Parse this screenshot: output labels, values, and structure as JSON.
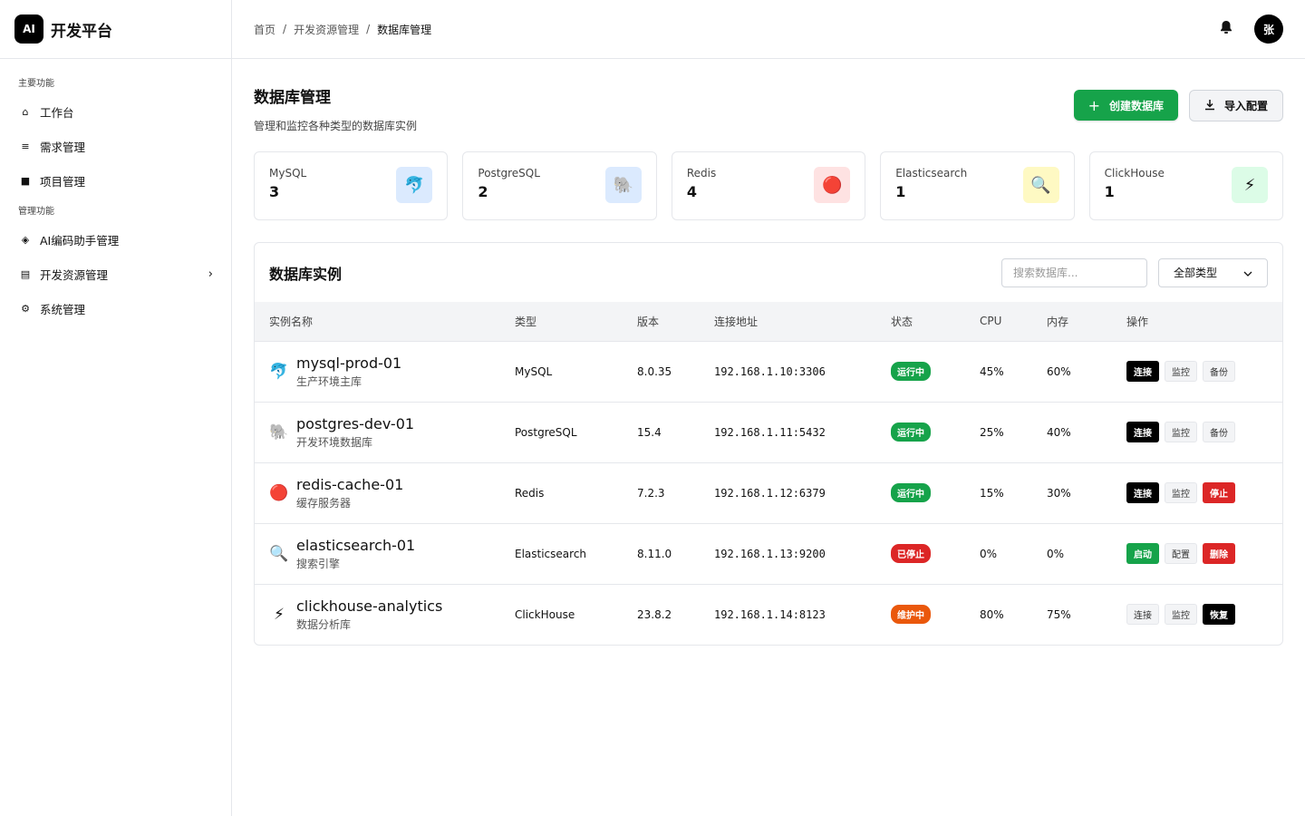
{
  "brand": {
    "logo": "AI",
    "name": "开发平台"
  },
  "sidebar": {
    "section_main": "主要功能",
    "section_manage": "管理功能",
    "main_items": [
      {
        "label": "工作台",
        "icon": "home-icon",
        "glyph": "⌂"
      },
      {
        "label": "需求管理",
        "icon": "list-icon",
        "glyph": "≡"
      },
      {
        "label": "项目管理",
        "icon": "briefcase-icon",
        "glyph": "■"
      }
    ],
    "manage_items": [
      {
        "label": "AI编码助手管理",
        "icon": "shield-icon",
        "glyph": "◈"
      },
      {
        "label": "开发资源管理",
        "icon": "resource-icon",
        "glyph": "▤"
      },
      {
        "label": "系统管理",
        "icon": "gear-icon",
        "glyph": "⚙"
      }
    ]
  },
  "breadcrumb": {
    "home": "首页",
    "parent": "开发资源管理",
    "current": "数据库管理",
    "sep": "/"
  },
  "header": {
    "avatar": "张"
  },
  "page": {
    "title": "数据库管理",
    "subtitle": "管理和监控各种类型的数据库实例",
    "create_label": "创建数据库",
    "import_label": "导入配置"
  },
  "stats": [
    {
      "name": "MySQL",
      "value": "3",
      "icon": "🐬",
      "bg": "#dbeafe"
    },
    {
      "name": "PostgreSQL",
      "value": "2",
      "icon": "🐘",
      "bg": "#dbeafe"
    },
    {
      "name": "Redis",
      "value": "4",
      "icon": "🔴",
      "bg": "#fee2e2"
    },
    {
      "name": "Elasticsearch",
      "value": "1",
      "icon": "🔍",
      "bg": "#fef9c3"
    },
    {
      "name": "ClickHouse",
      "value": "1",
      "icon": "⚡",
      "bg": "#dcfce7"
    }
  ],
  "panel": {
    "title": "数据库实例",
    "search_placeholder": "搜索数据库...",
    "filter_value": "全部类型"
  },
  "table": {
    "headers": [
      "实例名称",
      "类型",
      "版本",
      "连接地址",
      "状态",
      "CPU",
      "内存",
      "操作"
    ],
    "rows": [
      {
        "icon": "🐬",
        "name": "mysql-prod-01",
        "desc": "生产环境主库",
        "type": "MySQL",
        "version": "8.0.35",
        "addr": "192.168.1.10:3306",
        "status": "运行中",
        "status_kind": "run",
        "cpu": "45%",
        "mem": "60%",
        "ops": [
          {
            "label": "连接",
            "style": "dark"
          },
          {
            "label": "监控",
            "style": "light"
          },
          {
            "label": "备份",
            "style": "light"
          }
        ]
      },
      {
        "icon": "🐘",
        "name": "postgres-dev-01",
        "desc": "开发环境数据库",
        "type": "PostgreSQL",
        "version": "15.4",
        "addr": "192.168.1.11:5432",
        "status": "运行中",
        "status_kind": "run",
        "cpu": "25%",
        "mem": "40%",
        "ops": [
          {
            "label": "连接",
            "style": "dark"
          },
          {
            "label": "监控",
            "style": "light"
          },
          {
            "label": "备份",
            "style": "light"
          }
        ]
      },
      {
        "icon": "🔴",
        "name": "redis-cache-01",
        "desc": "缓存服务器",
        "type": "Redis",
        "version": "7.2.3",
        "addr": "192.168.1.12:6379",
        "status": "运行中",
        "status_kind": "run",
        "cpu": "15%",
        "mem": "30%",
        "ops": [
          {
            "label": "连接",
            "style": "dark"
          },
          {
            "label": "监控",
            "style": "light"
          },
          {
            "label": "停止",
            "style": "red"
          }
        ]
      },
      {
        "icon": "🔍",
        "name": "elasticsearch-01",
        "desc": "搜索引擎",
        "type": "Elasticsearch",
        "version": "8.11.0",
        "addr": "192.168.1.13:9200",
        "status": "已停止",
        "status_kind": "stop",
        "cpu": "0%",
        "mem": "0%",
        "ops": [
          {
            "label": "启动",
            "style": "green"
          },
          {
            "label": "配置",
            "style": "light"
          },
          {
            "label": "删除",
            "style": "red"
          }
        ]
      },
      {
        "icon": "⚡",
        "name": "clickhouse-analytics",
        "desc": "数据分析库",
        "type": "ClickHouse",
        "version": "23.8.2",
        "addr": "192.168.1.14:8123",
        "status": "维护中",
        "status_kind": "maint",
        "cpu": "80%",
        "mem": "75%",
        "ops": [
          {
            "label": "连接",
            "style": "light"
          },
          {
            "label": "监控",
            "style": "light"
          },
          {
            "label": "恢复",
            "style": "dark"
          }
        ]
      }
    ]
  }
}
